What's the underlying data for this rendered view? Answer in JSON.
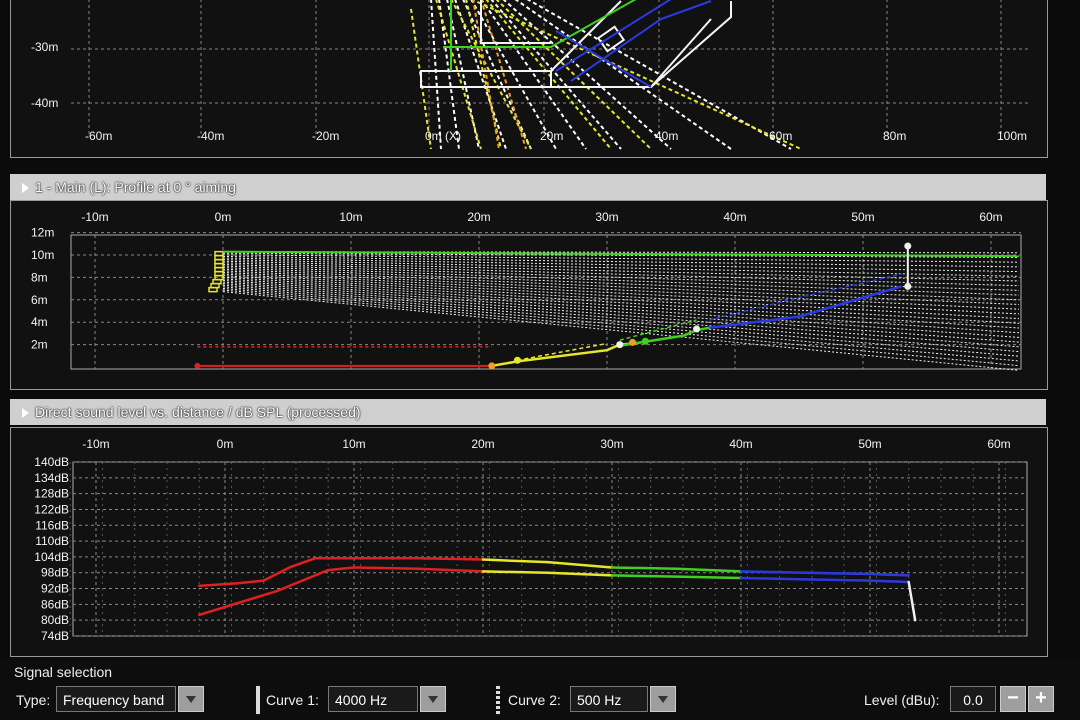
{
  "top_plot": {
    "y_ticks": [
      "-30m",
      "-40m"
    ],
    "x_ticks": [
      "-60m",
      "-40m",
      "-20m",
      "0m (X)",
      "20m",
      "40m",
      "60m",
      "80m",
      "100m"
    ]
  },
  "profile_section": {
    "header": "1 - Main (L): Profile at 0 ° aiming",
    "x_ticks": [
      "-10m",
      "0m",
      "10m",
      "20m",
      "30m",
      "40m",
      "50m",
      "60m"
    ],
    "y_ticks": [
      "12m",
      "10m",
      "8m",
      "6m",
      "4m",
      "2m"
    ]
  },
  "spl_section": {
    "header": "Direct sound level vs. distance / dB SPL (processed)",
    "x_ticks": [
      "-10m",
      "0m",
      "10m",
      "20m",
      "30m",
      "40m",
      "50m",
      "60m"
    ],
    "y_ticks": [
      "140dB",
      "134dB",
      "128dB",
      "122dB",
      "116dB",
      "110dB",
      "104dB",
      "98dB",
      "92dB",
      "86dB",
      "80dB",
      "74dB"
    ]
  },
  "chart_data": {
    "type": "line",
    "title": "Direct sound level vs. distance / dB SPL (processed)",
    "xlim": [
      -10,
      62
    ],
    "ylim": [
      74,
      140
    ],
    "series": [
      {
        "name": "4000 Hz",
        "x": [
          -2,
          1,
          3,
          5,
          7,
          10,
          15,
          20,
          25,
          30,
          35,
          40,
          45,
          50,
          53
        ],
        "values": [
          93,
          94,
          95,
          100,
          103.5,
          103.5,
          103.5,
          103,
          102,
          100,
          99.5,
          98.5,
          98,
          97.5,
          97
        ]
      },
      {
        "name": "500 Hz",
        "x": [
          -2,
          0,
          2,
          4,
          6,
          8,
          10,
          15,
          20,
          25,
          30,
          35,
          40,
          45,
          50,
          53,
          53.5
        ],
        "values": [
          82,
          85,
          88,
          91,
          95,
          99,
          100,
          99.5,
          98.5,
          98,
          97,
          96.5,
          96,
          95.5,
          95,
          94.5,
          80
        ]
      }
    ]
  },
  "signal_selection": {
    "title": "Signal selection",
    "type_label": "Type:",
    "type_value": "Frequency band",
    "curve1_label": "Curve 1:",
    "curve1_value": "4000 Hz",
    "curve2_label": "Curve 2:",
    "curve2_value": "500 Hz",
    "level_label": "Level (dBu):",
    "level_value": "0.0",
    "minus": "−",
    "plus": "+"
  }
}
